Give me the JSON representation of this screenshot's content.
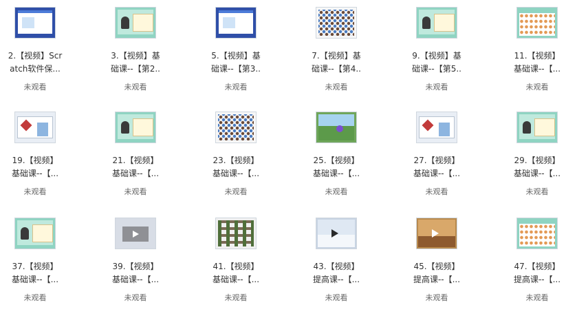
{
  "items": [
    {
      "title": "2.【视频】Scr\natch软件保...",
      "status": "未观看",
      "thumb": "blue"
    },
    {
      "title": "3.【视频】基\n础课--【第2..",
      "status": "未观看",
      "thumb": "mint"
    },
    {
      "title": "5.【视频】基\n础课--【第3..",
      "status": "未观看",
      "thumb": "blue"
    },
    {
      "title": "7.【视频】基\n础课--【第4..",
      "status": "未观看",
      "thumb": "grid"
    },
    {
      "title": "9.【视频】基\n础课--【第5..",
      "status": "未观看",
      "thumb": "mint"
    },
    {
      "title": "11.【视频】\n基础课--【...",
      "status": "未观看",
      "thumb": "mintgrid"
    },
    {
      "title": "19.【视频】\n基础课--【...",
      "status": "未观看",
      "thumb": "screen"
    },
    {
      "title": "21.【视频】\n基础课--【...",
      "status": "未观看",
      "thumb": "mint"
    },
    {
      "title": "23.【视频】\n基础课--【...",
      "status": "未观看",
      "thumb": "grid"
    },
    {
      "title": "25.【视频】\n基础课--【...",
      "status": "未观看",
      "thumb": "nature"
    },
    {
      "title": "27.【视频】\n基础课--【...",
      "status": "未观看",
      "thumb": "screen"
    },
    {
      "title": "29.【视频】\n基础课--【...",
      "status": "未观看",
      "thumb": "mint"
    },
    {
      "title": "37.【视频】\n基础课--【...",
      "status": "未观看",
      "thumb": "mint"
    },
    {
      "title": "39.【视频】\n基础课--【...",
      "status": "未观看",
      "thumb": "video"
    },
    {
      "title": "41.【视频】\n基础课--【...",
      "status": "未观看",
      "thumb": "photos"
    },
    {
      "title": "43.【视频】\n提高课--【...",
      "status": "未观看",
      "thumb": "winter"
    },
    {
      "title": "45.【视频】\n提高课--【...",
      "status": "未观看",
      "thumb": "room"
    },
    {
      "title": "47.【视频】\n提高课--【...",
      "status": "未观看",
      "thumb": "mintgrid"
    }
  ]
}
